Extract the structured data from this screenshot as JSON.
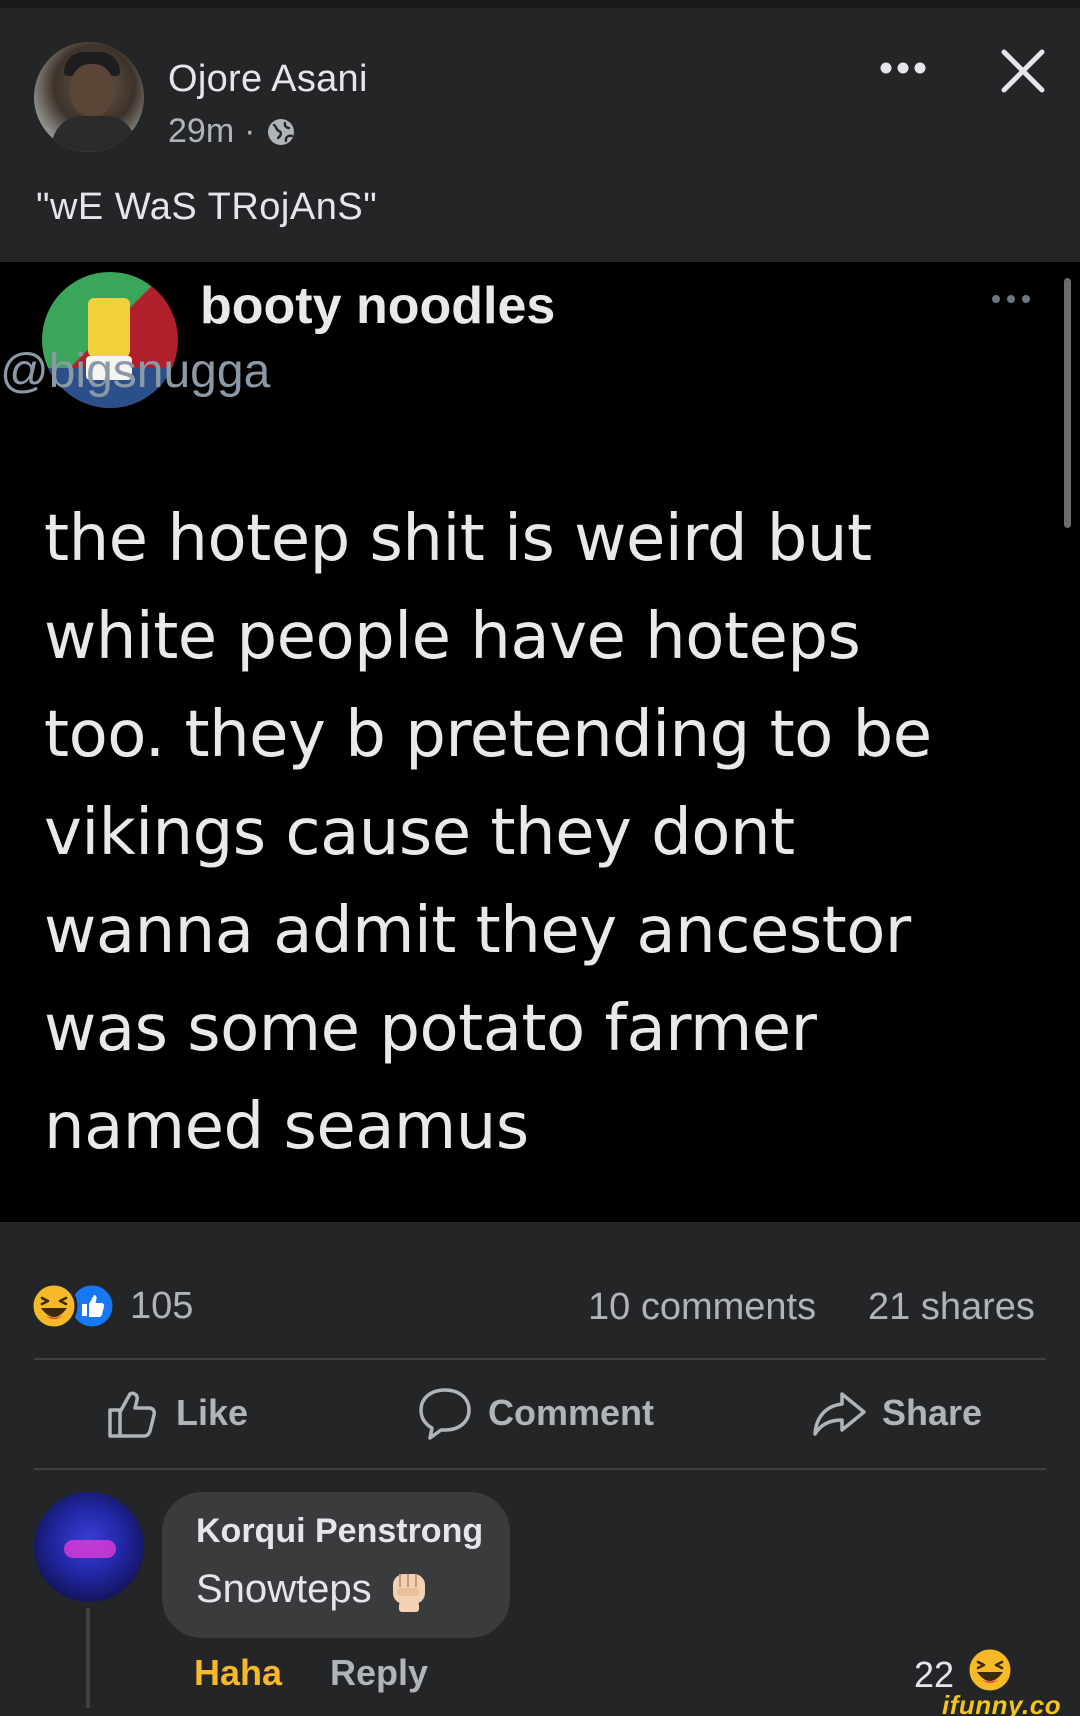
{
  "post": {
    "author": "Ojore Asani",
    "time": "29m",
    "separator": "·",
    "caption": "\"wE WaS TRojAnS\""
  },
  "tweet": {
    "display_name": "booty noodles",
    "handle": "@bigsnugga",
    "lines": [
      "the hotep shit is weird but",
      "white people have hoteps",
      "too. they b pretending to be",
      "vikings cause they dont",
      "wanna admit they ancestor",
      "was some potato farmer",
      "named seamus"
    ]
  },
  "stats": {
    "reactions": "105",
    "comments": "10 comments",
    "shares": "21 shares"
  },
  "actions": {
    "like": "Like",
    "comment": "Comment",
    "share": "Share"
  },
  "comment": {
    "author": "Korqui Penstrong",
    "text": "Snowteps",
    "reaction_label": "Haha",
    "reply_label": "Reply",
    "reaction_count": "22"
  },
  "watermark": "ifunny.co",
  "icons": [
    "globe-icon",
    "more-icon",
    "close-icon",
    "haha-icon",
    "like-reaction-icon",
    "like-icon",
    "comment-icon",
    "share-icon",
    "fist-icon"
  ],
  "colors": {
    "background": "#242526",
    "tweet_background": "#000000",
    "text_primary": "#e4e6eb",
    "text_secondary": "#b0b3b8",
    "like_blue": "#1877f2",
    "haha_yellow": "#f7b928"
  }
}
